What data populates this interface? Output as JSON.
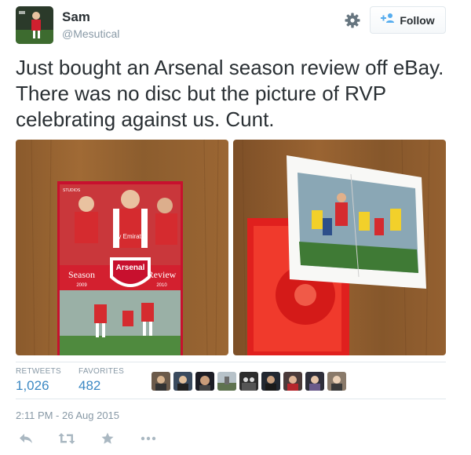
{
  "author": {
    "name": "Sam",
    "handle": "@Mesutical"
  },
  "header": {
    "follow_label": "Follow",
    "gear_icon": "gear-icon",
    "follow_icon": "add-user-icon"
  },
  "tweet": {
    "text": "Just bought an Arsenal season review off eBay. There was no disc but the picture of RVP celebrating against us. Cunt."
  },
  "photos": {
    "dvd_cover": {
      "studio": "STUDIOS",
      "sponsor": "Fly Emirates",
      "club": "Arsenal",
      "left_word": "Season",
      "left_year": "2009",
      "right_word": "Review",
      "right_year": "2010"
    }
  },
  "stats": {
    "retweets_label": "RETWEETS",
    "retweets_value": "1,026",
    "favorites_label": "FAVORITES",
    "favorites_value": "482"
  },
  "timestamp": "2:11 PM - 26 Aug 2015",
  "actions": [
    "reply-icon",
    "retweet-icon",
    "favorite-icon",
    "more-icon"
  ],
  "colors": {
    "link_blue": "#3b88c3",
    "muted": "#8899a6",
    "text": "#292f33",
    "arsenal_red": "#d0202f"
  }
}
